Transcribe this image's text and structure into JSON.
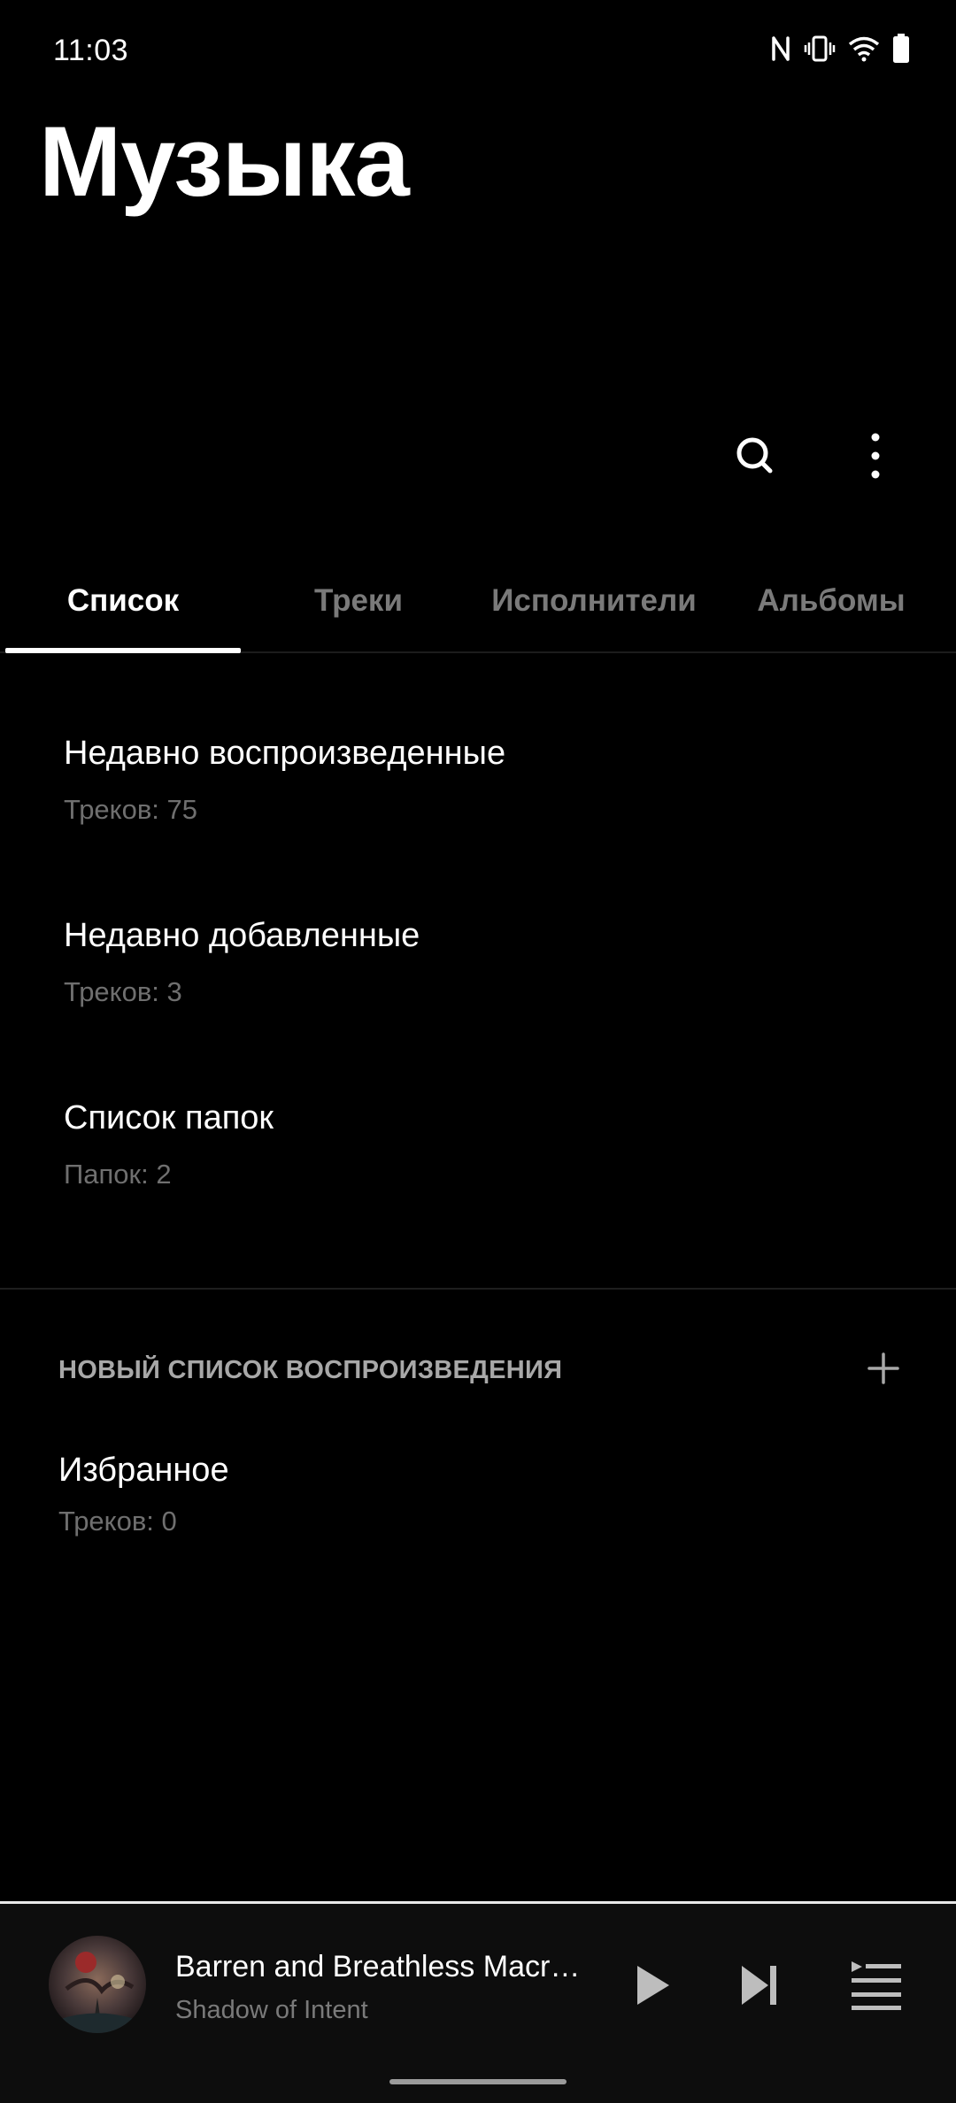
{
  "status": {
    "time": "11:03",
    "icons": [
      "nfc-icon",
      "vibrate-icon",
      "wifi-icon",
      "battery-icon"
    ]
  },
  "header": {
    "title": "Музыка"
  },
  "toolbar": {
    "icons": [
      "search-icon",
      "more-vertical-icon"
    ]
  },
  "tabs": [
    {
      "label": "Список",
      "active": true
    },
    {
      "label": "Треки",
      "active": false
    },
    {
      "label": "Исполнители",
      "active": false
    },
    {
      "label": "Альбомы",
      "active": false
    }
  ],
  "lists": [
    {
      "title": "Недавно воспроизведенные",
      "subtitle": "Треков: 75"
    },
    {
      "title": "Недавно добавленные",
      "subtitle": "Треков: 3"
    },
    {
      "title": "Список папок",
      "subtitle": "Папок: 2"
    }
  ],
  "playlists": {
    "header": "НОВЫЙ СПИСОК ВОСПРОИЗВЕДЕНИЯ",
    "items": [
      {
        "title": "Избранное",
        "subtitle": "Треков: 0"
      }
    ]
  },
  "player": {
    "title": "Barren and Breathless Macroc...",
    "artist": "Shadow of Intent",
    "icons": [
      "album-cover",
      "play-icon",
      "skip-next-icon",
      "queue-icon"
    ]
  },
  "colors": {
    "background": "#000000",
    "active_text": "#ffffff",
    "inactive_tab": "#7a7a7a",
    "secondary_text": "#6f6f6f"
  }
}
